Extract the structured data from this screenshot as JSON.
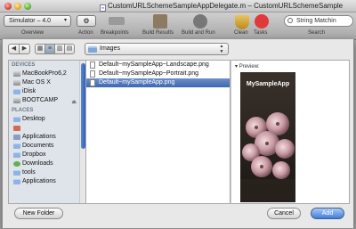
{
  "window": {
    "title": "CustomURLSchemeSampleAppDelegate.m – CustomURLSchemeSample",
    "doc_icon_label": "m"
  },
  "toolbar": {
    "scheme_label": "Simulator – 4.0",
    "overview_label": "Overview",
    "action_label": "Action",
    "breakpoints_label": "Breakpoints",
    "build_results_label": "Build Results",
    "build_and_run_label": "Build and Run",
    "clean_label": "Clean",
    "tasks_label": "Tasks",
    "search_value": "String Matchin",
    "search_label": "Search"
  },
  "open_panel": {
    "current_folder": "Images",
    "sidebar": {
      "devices_header": "DEVICES",
      "devices": [
        "MacBookPro6,2",
        "Mac OS X",
        "iDisk",
        "BOOTCAMP"
      ],
      "places_header": "PLACES",
      "places": [
        "Desktop",
        "",
        "Applications",
        "Documents",
        "Dropbox",
        "Downloads",
        "tools",
        "Applications"
      ]
    },
    "files": [
      "Default~mySampleApp~Landscape.png",
      "Default~mySampleApp~Portrait.png",
      "Default~mySampleApp.png"
    ],
    "selected_file_index": 2,
    "preview_label": "Preview:",
    "preview_image_title": "MySampleApp",
    "buttons": {
      "new_folder": "New Folder",
      "cancel": "Cancel",
      "add": "Add"
    }
  }
}
